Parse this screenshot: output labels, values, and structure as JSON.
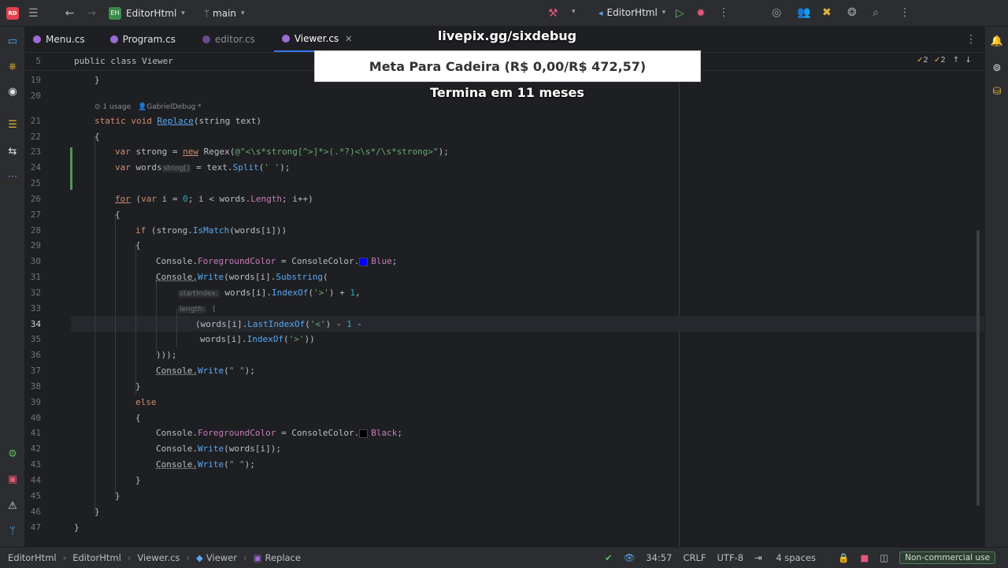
{
  "titlebar": {
    "app_icon": "RD",
    "project_badge": "EH",
    "project_name": "EditorHtml",
    "branch": "main",
    "run_config": "EditorHtml",
    "icons": [
      "hamburger-icon",
      "back-icon",
      "forward-icon",
      "hammer-icon",
      "run-icon",
      "debug-icon",
      "more-icon",
      "spiral-icon",
      "users-icon",
      "tools-icon",
      "ai-icon",
      "search-icon",
      "kebab-icon"
    ]
  },
  "tabs": [
    {
      "label": "Menu.cs"
    },
    {
      "label": "Program.cs"
    },
    {
      "label": "editor.cs"
    },
    {
      "label": "Viewer.cs"
    }
  ],
  "editor": {
    "sticky_line_number": "5",
    "sticky_line_text": "public class Viewer",
    "inspection_warnings": "2",
    "inspection_checks": "2",
    "lens_usages": "1 usage",
    "lens_author": "GabrielDebug *",
    "current_line": "34",
    "lines": [
      {
        "n": "19"
      },
      {
        "n": "20"
      },
      {
        "n": "21"
      },
      {
        "n": "22"
      },
      {
        "n": "23"
      },
      {
        "n": "24"
      },
      {
        "n": "25"
      },
      {
        "n": "26"
      },
      {
        "n": "27"
      },
      {
        "n": "28"
      },
      {
        "n": "29"
      },
      {
        "n": "30"
      },
      {
        "n": "31"
      },
      {
        "n": "32"
      },
      {
        "n": "33"
      },
      {
        "n": "34"
      },
      {
        "n": "35"
      },
      {
        "n": "36"
      },
      {
        "n": "37"
      },
      {
        "n": "38"
      },
      {
        "n": "39"
      },
      {
        "n": "40"
      },
      {
        "n": "41"
      },
      {
        "n": "42"
      },
      {
        "n": "43"
      },
      {
        "n": "44"
      },
      {
        "n": "45"
      },
      {
        "n": "46"
      },
      {
        "n": "47"
      }
    ],
    "code": {
      "l19": "}",
      "l21_kw": "static void",
      "l21_fn": "Replace",
      "l21_rest": "(string text)",
      "l22": "{",
      "l23_kw": "var",
      "l23_a": " strong = ",
      "l23_new": "new",
      "l23_b": " Regex(",
      "l23_str": "@\"<\\s*strong[^>]*>(.*?)<\\s*/\\s*strong>\"",
      "l23_c": ");",
      "l24_kw": "var",
      "l24_a": " words",
      "l24_hint": "string[]",
      "l24_b": " = text.",
      "l24_fn": "Split",
      "l24_c": "(",
      "l24_str": "' '",
      "l24_d": ");",
      "l26_kw": "for",
      "l26_a": " (",
      "l26_kw2": "var",
      "l26_b": " i = ",
      "l26_num": "0",
      "l26_c": "; i < words.",
      "l26_prop": "Length",
      "l26_d": "; i++)",
      "l27": "{",
      "l28_kw": "if",
      "l28_a": " (strong.",
      "l28_fn": "IsMatch",
      "l28_b": "(words[i]))",
      "l29": "{",
      "l30_a": "Console.",
      "l30_prop": "ForegroundColor",
      "l30_b": " = ConsoleColor.",
      "l30_enum": "Blue",
      "l30_c": ";",
      "l31_a": "Console.",
      "l31_fn": "Write",
      "l31_b": "(words[i].",
      "l31_fn2": "Substring",
      "l31_c": "(",
      "l32_hint": "startIndex:",
      "l32_a": " words[i].",
      "l32_fn": "IndexOf",
      "l32_b": "(",
      "l32_str": "'>'",
      "l32_c": ") + ",
      "l32_num": "1",
      "l32_d": ",",
      "l33_hint": "length:",
      "l33_a": " (",
      "l34_a": "(words[i].",
      "l34_fn": "LastIndexOf",
      "l34_b": "(",
      "l34_str": "'<'",
      "l34_c": ") - ",
      "l34_num": "1",
      "l34_d": " -",
      "l35_a": "words[i].",
      "l35_fn": "IndexOf",
      "l35_b": "(",
      "l35_str": "'>'",
      "l35_c": "))",
      "l36": ")));",
      "l37_a": "Console.",
      "l37_fn": "Write",
      "l37_b": "(",
      "l37_str": "\" \"",
      "l37_c": ");",
      "l38": "}",
      "l39_kw": "else",
      "l40": "{",
      "l41_a": "Console.",
      "l41_prop": "ForegroundColor",
      "l41_b": " = ConsoleColor.",
      "l41_enum": "Black",
      "l41_c": ";",
      "l42_a": "Console.",
      "l42_fn": "Write",
      "l42_b": "(words[i]);",
      "l43_a": "Console.",
      "l43_fn": "Write",
      "l43_b": "(",
      "l43_str": "\" \"",
      "l43_c": ");",
      "l44": "}",
      "l45": "}",
      "l46": "}",
      "l47": "}"
    },
    "swatch_colors": {
      "blue": "#0000ff",
      "black": "#000000"
    }
  },
  "overlay": {
    "url": "livepix.gg/sixdebug",
    "goal": "Meta Para Cadeira (R$ 0,00/R$ 472,57)",
    "subtitle": "Termina em 11 meses"
  },
  "statusbar": {
    "breadcrumbs": [
      "EditorHtml",
      "EditorHtml",
      "Viewer.cs",
      "Viewer",
      "Replace"
    ],
    "position": "34:57",
    "line_ending": "CRLF",
    "encoding": "UTF-8",
    "indent": "4 spaces",
    "license": "Non-commercial use"
  },
  "colors": {
    "accent": "#3574f0",
    "keyword": "#cf8e6d",
    "function": "#56a8f5",
    "string": "#6aab73",
    "number": "#2aacb8",
    "property": "#c77dbb"
  }
}
